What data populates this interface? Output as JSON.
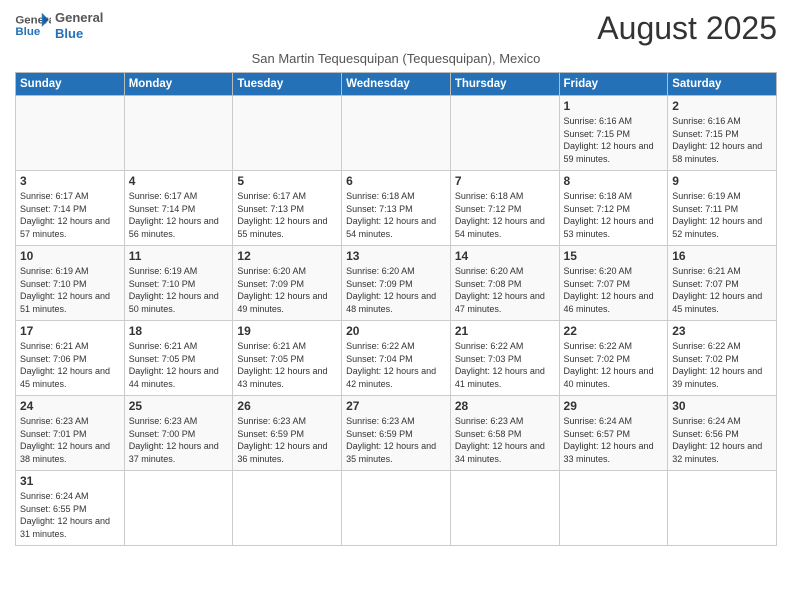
{
  "header": {
    "logo_general": "General",
    "logo_blue": "Blue",
    "month_year": "August 2025",
    "subtitle": "San Martin Tequesquipan (Tequesquipan), Mexico"
  },
  "weekdays": [
    "Sunday",
    "Monday",
    "Tuesday",
    "Wednesday",
    "Thursday",
    "Friday",
    "Saturday"
  ],
  "weeks": [
    [
      {
        "day": "",
        "info": ""
      },
      {
        "day": "",
        "info": ""
      },
      {
        "day": "",
        "info": ""
      },
      {
        "day": "",
        "info": ""
      },
      {
        "day": "",
        "info": ""
      },
      {
        "day": "1",
        "info": "Sunrise: 6:16 AM\nSunset: 7:15 PM\nDaylight: 12 hours\nand 59 minutes."
      },
      {
        "day": "2",
        "info": "Sunrise: 6:16 AM\nSunset: 7:15 PM\nDaylight: 12 hours\nand 58 minutes."
      }
    ],
    [
      {
        "day": "3",
        "info": "Sunrise: 6:17 AM\nSunset: 7:14 PM\nDaylight: 12 hours\nand 57 minutes."
      },
      {
        "day": "4",
        "info": "Sunrise: 6:17 AM\nSunset: 7:14 PM\nDaylight: 12 hours\nand 56 minutes."
      },
      {
        "day": "5",
        "info": "Sunrise: 6:17 AM\nSunset: 7:13 PM\nDaylight: 12 hours\nand 55 minutes."
      },
      {
        "day": "6",
        "info": "Sunrise: 6:18 AM\nSunset: 7:13 PM\nDaylight: 12 hours\nand 54 minutes."
      },
      {
        "day": "7",
        "info": "Sunrise: 6:18 AM\nSunset: 7:12 PM\nDaylight: 12 hours\nand 54 minutes."
      },
      {
        "day": "8",
        "info": "Sunrise: 6:18 AM\nSunset: 7:12 PM\nDaylight: 12 hours\nand 53 minutes."
      },
      {
        "day": "9",
        "info": "Sunrise: 6:19 AM\nSunset: 7:11 PM\nDaylight: 12 hours\nand 52 minutes."
      }
    ],
    [
      {
        "day": "10",
        "info": "Sunrise: 6:19 AM\nSunset: 7:10 PM\nDaylight: 12 hours\nand 51 minutes."
      },
      {
        "day": "11",
        "info": "Sunrise: 6:19 AM\nSunset: 7:10 PM\nDaylight: 12 hours\nand 50 minutes."
      },
      {
        "day": "12",
        "info": "Sunrise: 6:20 AM\nSunset: 7:09 PM\nDaylight: 12 hours\nand 49 minutes."
      },
      {
        "day": "13",
        "info": "Sunrise: 6:20 AM\nSunset: 7:09 PM\nDaylight: 12 hours\nand 48 minutes."
      },
      {
        "day": "14",
        "info": "Sunrise: 6:20 AM\nSunset: 7:08 PM\nDaylight: 12 hours\nand 47 minutes."
      },
      {
        "day": "15",
        "info": "Sunrise: 6:20 AM\nSunset: 7:07 PM\nDaylight: 12 hours\nand 46 minutes."
      },
      {
        "day": "16",
        "info": "Sunrise: 6:21 AM\nSunset: 7:07 PM\nDaylight: 12 hours\nand 45 minutes."
      }
    ],
    [
      {
        "day": "17",
        "info": "Sunrise: 6:21 AM\nSunset: 7:06 PM\nDaylight: 12 hours\nand 45 minutes."
      },
      {
        "day": "18",
        "info": "Sunrise: 6:21 AM\nSunset: 7:05 PM\nDaylight: 12 hours\nand 44 minutes."
      },
      {
        "day": "19",
        "info": "Sunrise: 6:21 AM\nSunset: 7:05 PM\nDaylight: 12 hours\nand 43 minutes."
      },
      {
        "day": "20",
        "info": "Sunrise: 6:22 AM\nSunset: 7:04 PM\nDaylight: 12 hours\nand 42 minutes."
      },
      {
        "day": "21",
        "info": "Sunrise: 6:22 AM\nSunset: 7:03 PM\nDaylight: 12 hours\nand 41 minutes."
      },
      {
        "day": "22",
        "info": "Sunrise: 6:22 AM\nSunset: 7:02 PM\nDaylight: 12 hours\nand 40 minutes."
      },
      {
        "day": "23",
        "info": "Sunrise: 6:22 AM\nSunset: 7:02 PM\nDaylight: 12 hours\nand 39 minutes."
      }
    ],
    [
      {
        "day": "24",
        "info": "Sunrise: 6:23 AM\nSunset: 7:01 PM\nDaylight: 12 hours\nand 38 minutes."
      },
      {
        "day": "25",
        "info": "Sunrise: 6:23 AM\nSunset: 7:00 PM\nDaylight: 12 hours\nand 37 minutes."
      },
      {
        "day": "26",
        "info": "Sunrise: 6:23 AM\nSunset: 6:59 PM\nDaylight: 12 hours\nand 36 minutes."
      },
      {
        "day": "27",
        "info": "Sunrise: 6:23 AM\nSunset: 6:59 PM\nDaylight: 12 hours\nand 35 minutes."
      },
      {
        "day": "28",
        "info": "Sunrise: 6:23 AM\nSunset: 6:58 PM\nDaylight: 12 hours\nand 34 minutes."
      },
      {
        "day": "29",
        "info": "Sunrise: 6:24 AM\nSunset: 6:57 PM\nDaylight: 12 hours\nand 33 minutes."
      },
      {
        "day": "30",
        "info": "Sunrise: 6:24 AM\nSunset: 6:56 PM\nDaylight: 12 hours\nand 32 minutes."
      }
    ],
    [
      {
        "day": "31",
        "info": "Sunrise: 6:24 AM\nSunset: 6:55 PM\nDaylight: 12 hours\nand 31 minutes."
      },
      {
        "day": "",
        "info": ""
      },
      {
        "day": "",
        "info": ""
      },
      {
        "day": "",
        "info": ""
      },
      {
        "day": "",
        "info": ""
      },
      {
        "day": "",
        "info": ""
      },
      {
        "day": "",
        "info": ""
      }
    ]
  ]
}
